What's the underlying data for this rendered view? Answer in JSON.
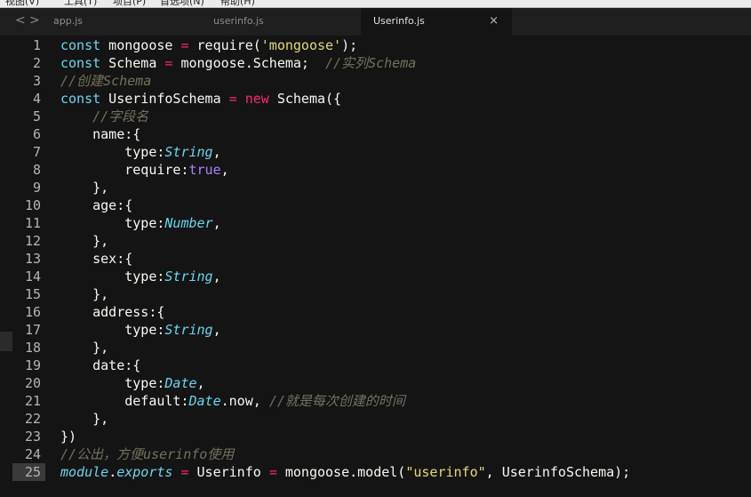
{
  "menubar": {
    "items": [
      "视图(V)",
      "工具(T)",
      "项目(P)",
      "首选项(N)",
      "帮助(H)"
    ]
  },
  "tabs": [
    {
      "label": "app.js"
    },
    {
      "label": "userinfo.js"
    },
    {
      "label": "Userinfo.js",
      "active": true
    }
  ],
  "nav": {
    "back": "<",
    "forward": ">"
  },
  "close_glyph": "×",
  "lines": [
    {
      "num": "1",
      "tokens": [
        [
          "kw",
          "const"
        ],
        [
          "t",
          " mongoose "
        ],
        [
          "op",
          "="
        ],
        [
          "t",
          " require("
        ],
        [
          "str",
          "'mongoose'"
        ],
        [
          "t",
          ");"
        ]
      ]
    },
    {
      "num": "2",
      "tokens": [
        [
          "kw",
          "const"
        ],
        [
          "t",
          " Schema "
        ],
        [
          "op",
          "="
        ],
        [
          "t",
          " mongoose.Schema;  "
        ],
        [
          "cmt",
          "//实列Schema"
        ]
      ]
    },
    {
      "num": "3",
      "tokens": [
        [
          "cmt",
          "//创建Schema"
        ]
      ]
    },
    {
      "num": "4",
      "tokens": [
        [
          "kw",
          "const"
        ],
        [
          "t",
          " UserinfoSchema "
        ],
        [
          "op",
          "="
        ],
        [
          "t",
          " "
        ],
        [
          "op",
          "new"
        ],
        [
          "t",
          " Schema({"
        ]
      ]
    },
    {
      "num": "5",
      "tokens": [
        [
          "t",
          "    "
        ],
        [
          "cmt",
          "//字段名"
        ]
      ]
    },
    {
      "num": "6",
      "tokens": [
        [
          "t",
          "    name:{"
        ]
      ]
    },
    {
      "num": "7",
      "tokens": [
        [
          "t",
          "        type:"
        ],
        [
          "typ",
          "String"
        ],
        [
          "t",
          ","
        ]
      ]
    },
    {
      "num": "8",
      "tokens": [
        [
          "t",
          "        require:"
        ],
        [
          "bool",
          "true"
        ],
        [
          "t",
          ","
        ]
      ]
    },
    {
      "num": "9",
      "tokens": [
        [
          "t",
          "    },"
        ]
      ]
    },
    {
      "num": "10",
      "tokens": [
        [
          "t",
          "    age:{"
        ]
      ]
    },
    {
      "num": "11",
      "tokens": [
        [
          "t",
          "        type:"
        ],
        [
          "typ",
          "Number"
        ],
        [
          "t",
          ","
        ]
      ]
    },
    {
      "num": "12",
      "tokens": [
        [
          "t",
          "    },"
        ]
      ]
    },
    {
      "num": "13",
      "tokens": [
        [
          "t",
          "    sex:{"
        ]
      ]
    },
    {
      "num": "14",
      "tokens": [
        [
          "t",
          "        type:"
        ],
        [
          "typ",
          "String"
        ],
        [
          "t",
          ","
        ]
      ]
    },
    {
      "num": "15",
      "tokens": [
        [
          "t",
          "    },"
        ]
      ]
    },
    {
      "num": "16",
      "tokens": [
        [
          "t",
          "    address:{"
        ]
      ]
    },
    {
      "num": "17",
      "tokens": [
        [
          "t",
          "        type:"
        ],
        [
          "typ",
          "String"
        ],
        [
          "t",
          ","
        ]
      ]
    },
    {
      "num": "18",
      "tokens": [
        [
          "t",
          "    },"
        ]
      ]
    },
    {
      "num": "19",
      "tokens": [
        [
          "t",
          "    date:{"
        ]
      ]
    },
    {
      "num": "20",
      "tokens": [
        [
          "t",
          "        type:"
        ],
        [
          "typ",
          "Date"
        ],
        [
          "t",
          ","
        ]
      ]
    },
    {
      "num": "21",
      "tokens": [
        [
          "t",
          "        default:"
        ],
        [
          "typ",
          "Date"
        ],
        [
          "t",
          ".now, "
        ],
        [
          "cmt",
          "//就是每次创建的时间"
        ]
      ]
    },
    {
      "num": "22",
      "tokens": [
        [
          "t",
          "    },"
        ]
      ]
    },
    {
      "num": "23",
      "tokens": [
        [
          "t",
          "})"
        ]
      ]
    },
    {
      "num": "24",
      "tokens": [
        [
          "cmt",
          "//公出，方便userinfo使用"
        ]
      ]
    },
    {
      "num": "25",
      "tokens": [
        [
          "ital-kw",
          "module"
        ],
        [
          "t",
          "."
        ],
        [
          "ital-kw",
          "exports"
        ],
        [
          "t",
          " "
        ],
        [
          "op",
          "="
        ],
        [
          "t",
          " Userinfo "
        ],
        [
          "op",
          "="
        ],
        [
          "t",
          " mongoose.model("
        ],
        [
          "str",
          "\"userinfo\""
        ],
        [
          "t",
          ", UserinfoSchema);"
        ]
      ],
      "current": true
    }
  ],
  "colors": {
    "background": "#141414",
    "keyword": "#66d9ef",
    "operator": "#f92672",
    "string": "#e6db74",
    "comment": "#75715e",
    "boolean": "#ae81ff"
  }
}
